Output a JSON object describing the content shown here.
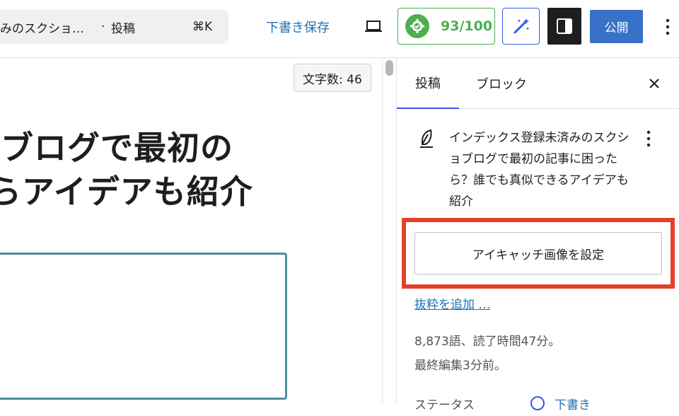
{
  "toolbar": {
    "doc_title": "みのスクショ…",
    "separator": "·",
    "doc_type": "投稿",
    "shortcut": "⌘K",
    "save_draft": "下書き保存",
    "preview_icon": "laptop-icon",
    "score": "93/100",
    "score_icon": "gear-icon",
    "magic_icon": "magic-wand-icon",
    "settings_icon": "sidebar-toggle-icon",
    "publish": "公開",
    "more_icon": "vertical-ellipsis-icon"
  },
  "editor": {
    "word_count": "文字数: 46",
    "title_line1": " ブログで最初の",
    "title_line2": "らアイデアも紹介"
  },
  "sidebar": {
    "tabs": [
      "投稿",
      "ブロック"
    ],
    "close_icon": "close-icon",
    "post_icon": "feather-icon",
    "post_summary": "インデックス登録未済みのスクショブログで最初の記事に困ったら？誰でも真似できるアイデアも紹介",
    "featured_image_button": "アイキャッチ画像を設定",
    "excerpt_link": "抜粋を追加 …",
    "stats_words": "8,873語、読了時間47分。",
    "stats_edited": "最終編集3分前。",
    "status_label": "ステータス",
    "status_value": "下書き"
  },
  "colors": {
    "accent": "#3858e9",
    "link": "#2271b1",
    "score_green": "#4caf50",
    "publish_blue": "#3771c8",
    "highlight_red": "#e6402a",
    "image_block_border": "#4a8fa0"
  }
}
